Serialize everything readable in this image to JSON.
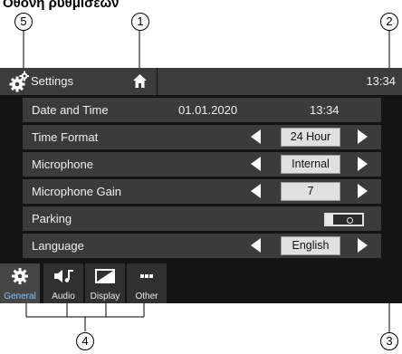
{
  "heading": "Οθόνη ρυθμίσεων",
  "callouts": [
    "1",
    "2",
    "3",
    "4",
    "5"
  ],
  "header": {
    "title": "Settings",
    "time": "13:34",
    "settings_icon": "gear-icon",
    "home_icon": "home-icon"
  },
  "rows": [
    {
      "name": "Date and Time",
      "date": "01.01.2020",
      "time": "13:34"
    },
    {
      "name": "Time Format",
      "value": "24 Hour"
    },
    {
      "name": "Microphone",
      "value": "Internal"
    },
    {
      "name": "Microphone Gain",
      "value": "7"
    },
    {
      "name": "Parking",
      "toggle": "off"
    },
    {
      "name": "Language",
      "value": "English"
    }
  ],
  "tabs": [
    {
      "label": "General",
      "icon": "gear-icon",
      "active": true
    },
    {
      "label": "Audio",
      "icon": "speaker-music-icon"
    },
    {
      "label": "Display",
      "icon": "display-icon"
    },
    {
      "label": "Other",
      "icon": "more-dots-icon"
    }
  ],
  "colors": {
    "active_tab_label": "#7dc3ff",
    "panel": "#141414",
    "row": "#3b3b3b"
  }
}
